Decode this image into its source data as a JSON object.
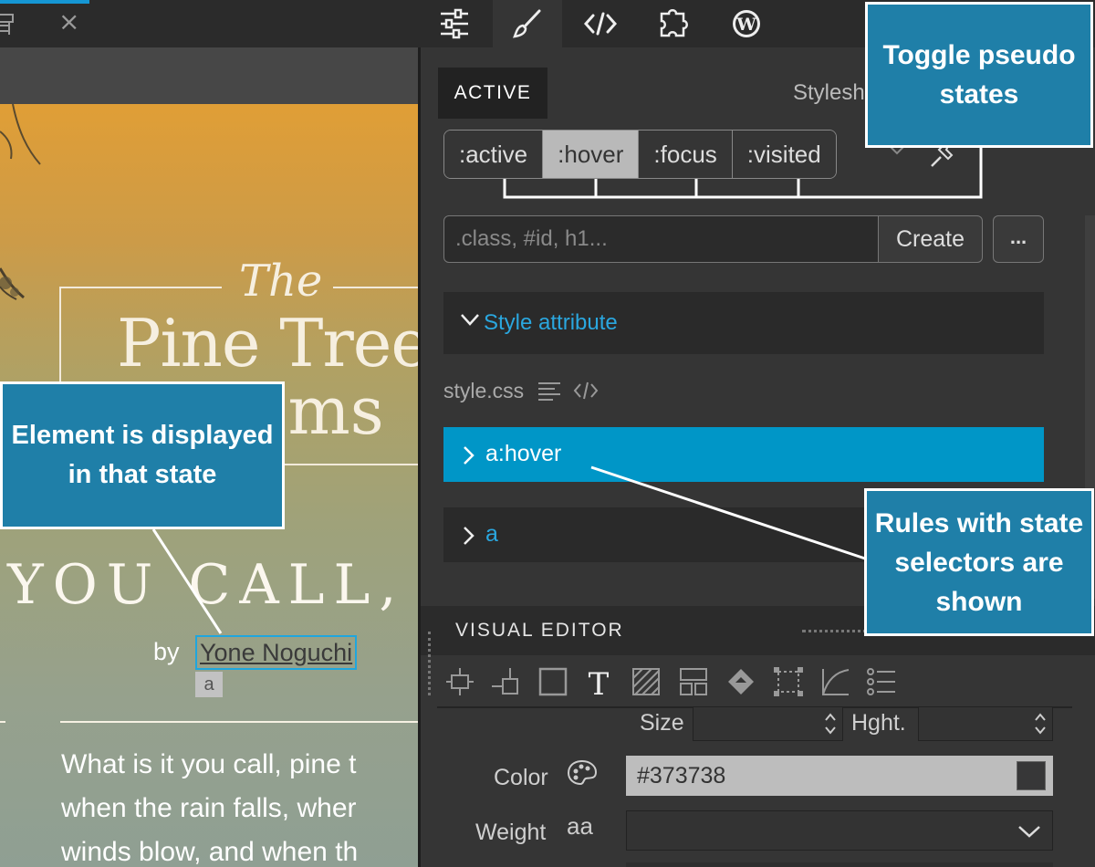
{
  "preview": {
    "tab_close": "×",
    "title_the": "The",
    "title_main": "Pine Trees",
    "title_poems": "Poems",
    "subtitle": "YOU CALL,",
    "byline_prefix": "by",
    "author_link": "Yone Noguchi",
    "element_tag": "a",
    "body_lines": [
      "What is it you call, pine t",
      "when the rain falls, wher",
      "winds blow, and when th"
    ]
  },
  "topbar": {
    "buttons": [
      {
        "icon": "sliders-icon",
        "active": false
      },
      {
        "icon": "brush-icon",
        "active": true
      },
      {
        "icon": "code-icon",
        "active": false
      },
      {
        "icon": "puzzle-icon",
        "active": false
      },
      {
        "icon": "wordpress-icon",
        "active": false
      }
    ]
  },
  "panel": {
    "tab_active": "ACTIVE",
    "tab_stylesheet": "Stylesheets",
    "pseudo_states": [
      {
        "label": ":active",
        "on": false
      },
      {
        "label": ":hover",
        "on": true
      },
      {
        "label": ":focus",
        "on": false
      },
      {
        "label": ":visited",
        "on": false
      }
    ],
    "selector_placeholder": ".class, #id, h1...",
    "create_label": "Create",
    "more_label": "...",
    "style_attribute_label": "Style attribute",
    "stylesheet_name": "style.css",
    "rules": [
      {
        "selector": "a:hover",
        "selected": true
      },
      {
        "selector": "a",
        "selected": false
      }
    ],
    "visual_editor_label": "VISUAL EDITOR",
    "size_label": "Size",
    "height_label": "Hght.",
    "color_label": "Color",
    "color_value": "#373738",
    "weight_label": "Weight",
    "weight_icon_text": "aa"
  },
  "callouts": {
    "pseudo_states": "Toggle pseudo states",
    "element_state": "Element is displayed in that state",
    "rules_shown": "Rules with state selectors are shown"
  },
  "colors": {
    "accent": "#0096c7",
    "link_blue": "#2aa7df",
    "callout_bg": "#1f7fa8",
    "panel_bg": "#353535",
    "swatch": "#373738"
  }
}
